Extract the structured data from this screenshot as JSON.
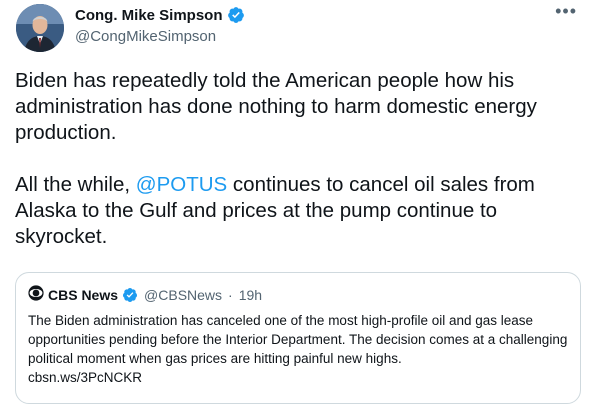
{
  "tweet": {
    "author": {
      "name": "Cong. Mike Simpson",
      "handle": "@CongMikeSimpson",
      "verified": true
    },
    "more_icon": "more-options-icon",
    "text": {
      "para1": "Biden has repeatedly told the American people how his administration has done nothing to harm domestic energy production.",
      "para2_before": "All the while, ",
      "para2_mention": "@POTUS",
      "para2_after": " continues to cancel oil sales from Alaska to the Gulf and prices at the pump continue to skyrocket."
    }
  },
  "quoted_tweet": {
    "author": {
      "name": "CBS News",
      "handle": "@CBSNews",
      "separator": "·",
      "time": "19h",
      "verified": true,
      "logo_icon": "cbs-eye-logo-icon"
    },
    "text": "The Biden administration has canceled one of the most high-profile oil and gas lease opportunities pending before the Interior Department. The decision comes at a challenging political moment when gas prices are hitting painful new highs.",
    "link": "cbsn.ws/3PcNCKR"
  },
  "colors": {
    "link_blue": "#1d9bf0",
    "verified_blue": "#1d9bf0",
    "secondary_text": "#536471",
    "border": "#cfd9de"
  }
}
